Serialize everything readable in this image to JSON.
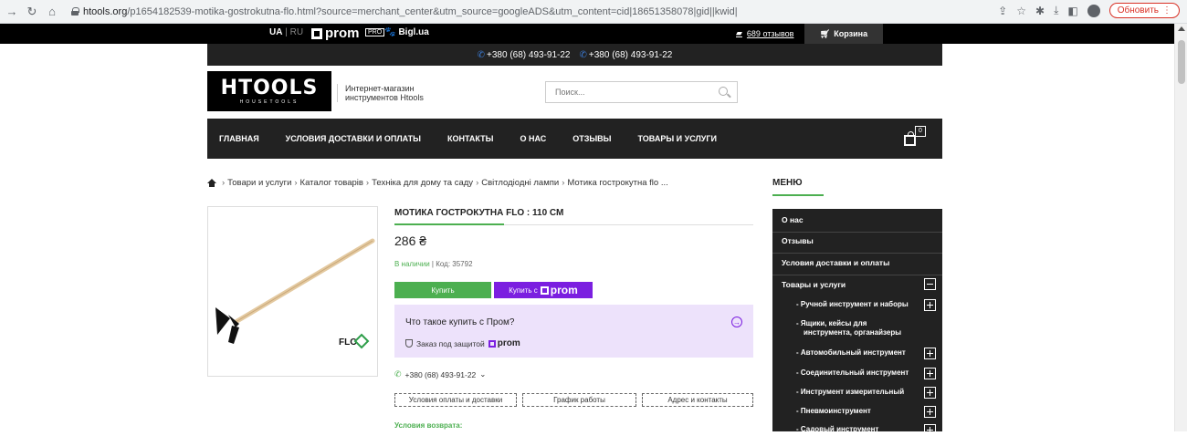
{
  "browser": {
    "url_host": "htools.org",
    "url_path": "/p1654182539-motika-gostrokutna-flo.html?source=merchant_center&utm_source=googleADS&utm_content=cid|18651358078|gid||kwid|",
    "update_label": "Обновить"
  },
  "topbar": {
    "lang_ua": "UA",
    "lang_sep": " | ",
    "lang_ru": "RU",
    "prom_label": "prom",
    "pro_badge": "PRO",
    "bigl_label": "Bigl.ua",
    "reviews_label": "689 отзывов",
    "cart_label": "Корзина"
  },
  "phones": [
    "+380 (68) 493-91-22",
    "+380 (68) 493-91-22"
  ],
  "header": {
    "logo_text": "HTOOLS",
    "logo_sub": "HOUSETOOLS",
    "tagline_line1": "Интернет-магазин",
    "tagline_line2": "инструментов Htools",
    "search_placeholder": "Поиск..."
  },
  "nav": {
    "items": [
      "ГЛАВНАЯ",
      "УСЛОВИЯ ДОСТАВКИ И ОПЛАТЫ",
      "КОНТАКТЫ",
      "О НАС",
      "ОТЗЫВЫ",
      "ТОВАРЫ И УСЛУГИ"
    ],
    "cart_count": "0"
  },
  "breadcrumb": [
    "Товари и услуги",
    "Каталог товарів",
    "Техніка для дому та саду",
    "Світлодіодні лампи",
    "Мотика гострокутна flo ..."
  ],
  "product": {
    "title": "МОТИКА ГОСТРОКУТНА FLO : 110 СМ",
    "price": "286 ₴",
    "stock": "В наличии",
    "code": "Код: 35792",
    "buy_label": "Купить",
    "buy_prom_prefix": "Купить с",
    "prom_word": "prom",
    "promo_title": "Что такое купить с Пром?",
    "promo_sub": "Заказ под защитой",
    "phone": "+380 (68) 493-91-22",
    "tabs": [
      "Условия оплаты и доставки",
      "График работы",
      "Адрес и контакты"
    ],
    "return_label": "Условия возврата:",
    "brand_mark": "FLO"
  },
  "menu": {
    "title": "МЕНЮ",
    "items": [
      "О нас",
      "Отзывы",
      "Условия доставки и оплаты",
      "Товары и услуги"
    ],
    "sub": [
      "- Ручной инструмент и наборы",
      "- Ящики, кейсы для",
      "инструмента, органайзеры",
      "- Автомобильный инструмент",
      "- Соединительный инструмент",
      "- Инструмент измерительный",
      "- Пневмоинструмент",
      "- Садовый инструмент"
    ]
  },
  "colors": {
    "accent_green": "#4caf50",
    "prom_purple": "#7b1fe0",
    "dark": "#222222"
  }
}
